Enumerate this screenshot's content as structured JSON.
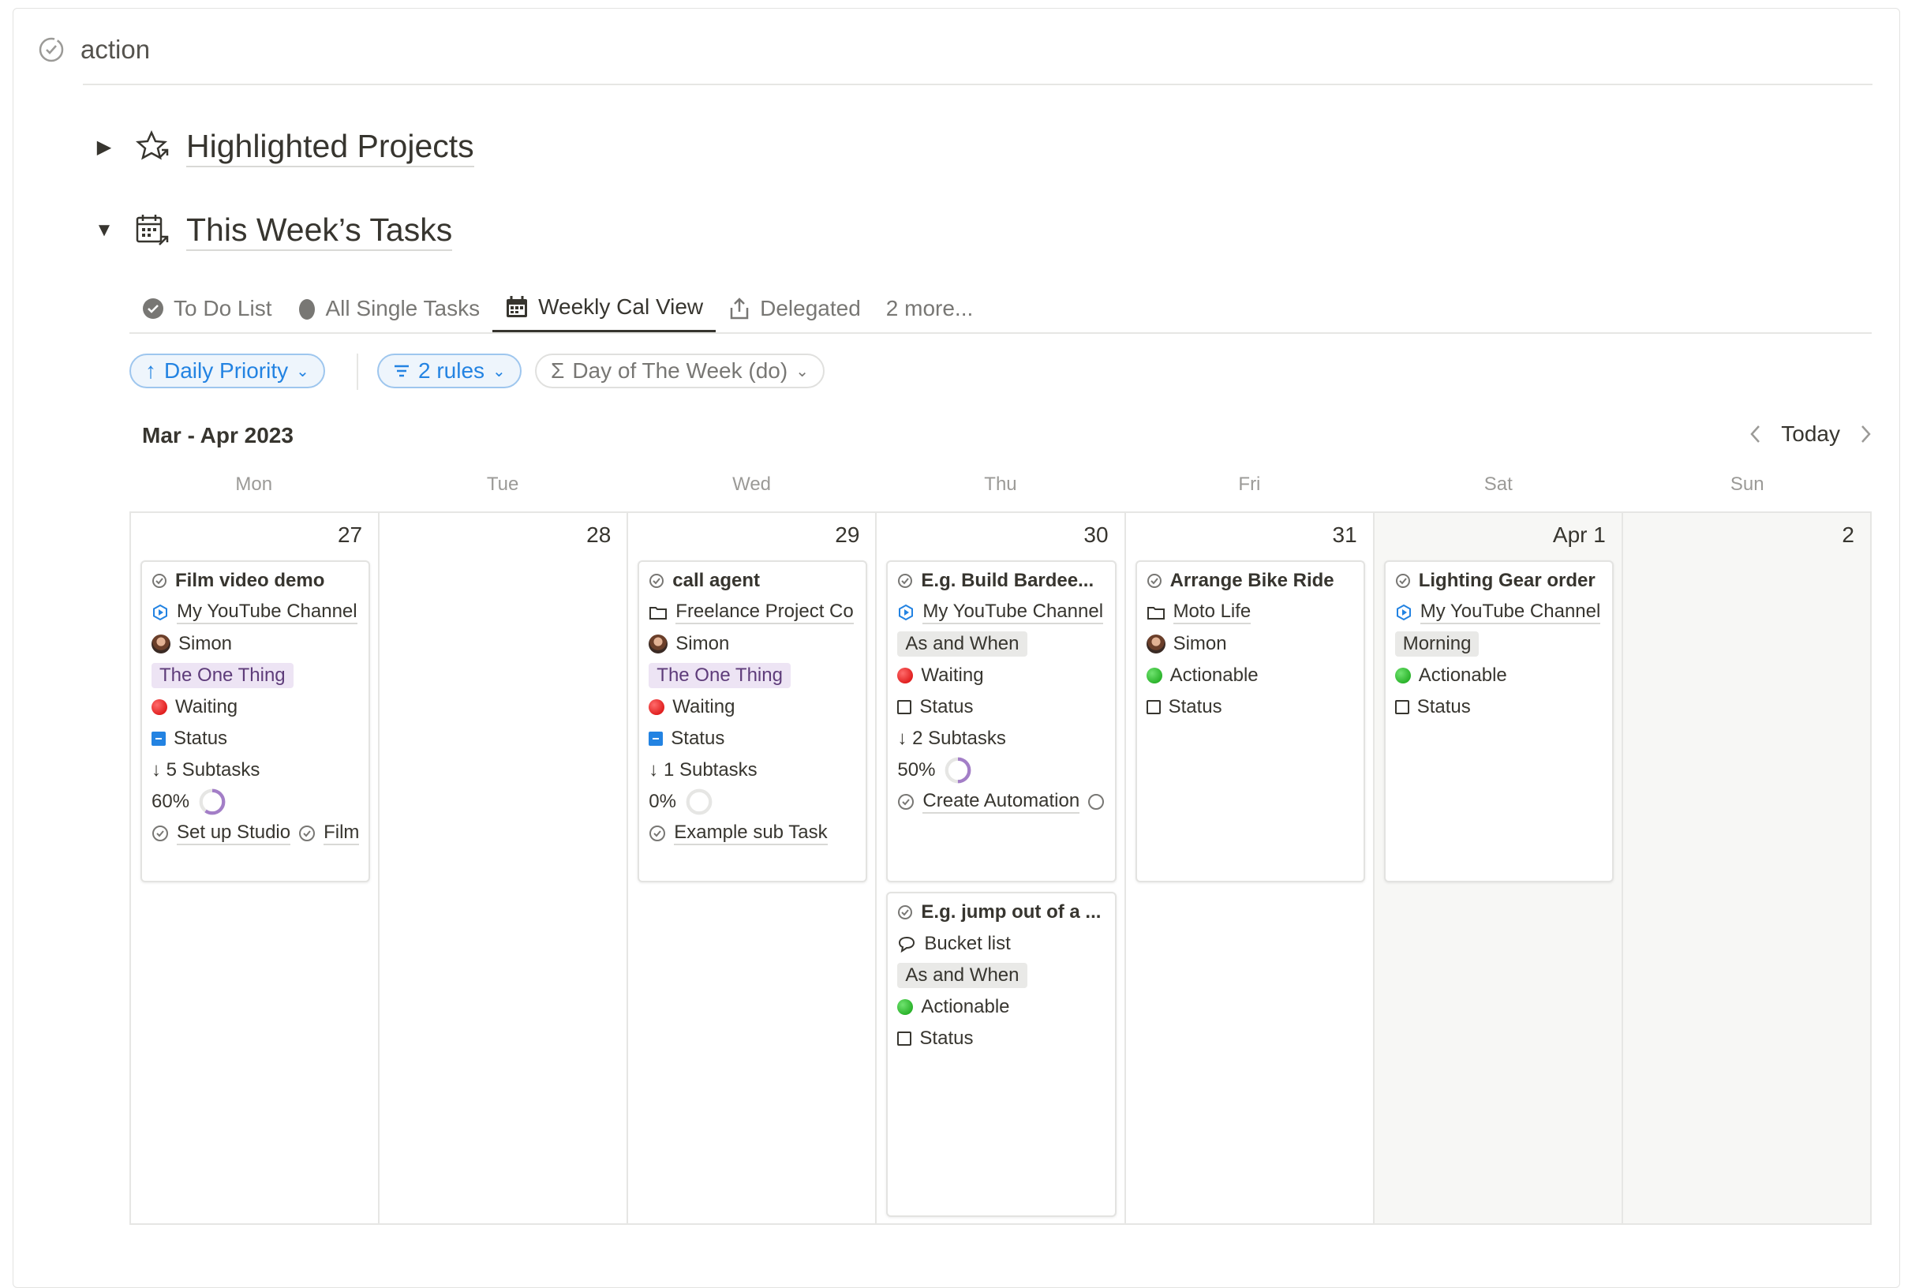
{
  "page": {
    "title": "action"
  },
  "sections": [
    {
      "title": "Highlighted Projects",
      "expanded": false,
      "icon": "star-arrow-icon"
    },
    {
      "title": "This Week’s Tasks",
      "expanded": true,
      "icon": "calendar-arrow-icon"
    }
  ],
  "tabs": [
    {
      "label": "To Do List",
      "icon": "check-circle-icon",
      "active": false
    },
    {
      "label": "All Single Tasks",
      "icon": "drop-icon",
      "active": false
    },
    {
      "label": "Weekly Cal View",
      "icon": "calendar-icon",
      "active": true
    },
    {
      "label": "Delegated",
      "icon": "share-icon",
      "active": false
    },
    {
      "label": "2 more...",
      "active": false
    }
  ],
  "filters": {
    "sort": "Daily Priority",
    "rules": "2 rules",
    "group": "Day of The Week (do)"
  },
  "calendar": {
    "month_label": "Mar - Apr 2023",
    "today_label": "Today",
    "weekdays": [
      "Mon",
      "Tue",
      "Wed",
      "Thu",
      "Fri",
      "Sat",
      "Sun"
    ],
    "days": [
      "27",
      "28",
      "29",
      "30",
      "31",
      "Apr 1",
      "2"
    ]
  },
  "cards": {
    "mon": {
      "title": "Film video demo",
      "project": "My YouTube Channel",
      "person": "Simon",
      "tag": "The One Thing",
      "state": "Waiting",
      "status": "Status",
      "subtasks": "↓ 5 Subtasks",
      "progress": "60%",
      "progress_value": 0.6,
      "sub1": "Set up Studio",
      "sub2": "Film"
    },
    "wed": {
      "title": "call agent",
      "project": "Freelance Project Co",
      "person": "Simon",
      "tag": "The One Thing",
      "state": "Waiting",
      "status": "Status",
      "subtasks": "↓ 1 Subtasks",
      "progress": "0%",
      "progress_value": 0,
      "sub1": "Example sub Task"
    },
    "thu1": {
      "title": "E.g. Build Bardee...",
      "project": "My YouTube Channel",
      "tag": "As and When",
      "state": "Waiting",
      "status": "Status",
      "subtasks": "↓ 2 Subtasks",
      "progress": "50%",
      "progress_value": 0.5,
      "sub1": "Create Automation"
    },
    "thu2": {
      "title": "E.g. jump out of a ...",
      "project": "Bucket list",
      "tag": "As and When",
      "state": "Actionable",
      "status": "Status"
    },
    "fri": {
      "title": "Arrange Bike Ride",
      "project": "Moto Life",
      "person": "Simon",
      "state": "Actionable",
      "status": "Status"
    },
    "sat": {
      "title": "Lighting Gear order",
      "project": "My YouTube Channel",
      "tag": "Morning",
      "state": "Actionable",
      "status": "Status"
    }
  },
  "colors": {
    "accent": "#2383e2",
    "progress": "#a37ec7",
    "waiting": "#e02020",
    "actionable": "#1aa51a",
    "tag_purple": "#ede4f4"
  }
}
